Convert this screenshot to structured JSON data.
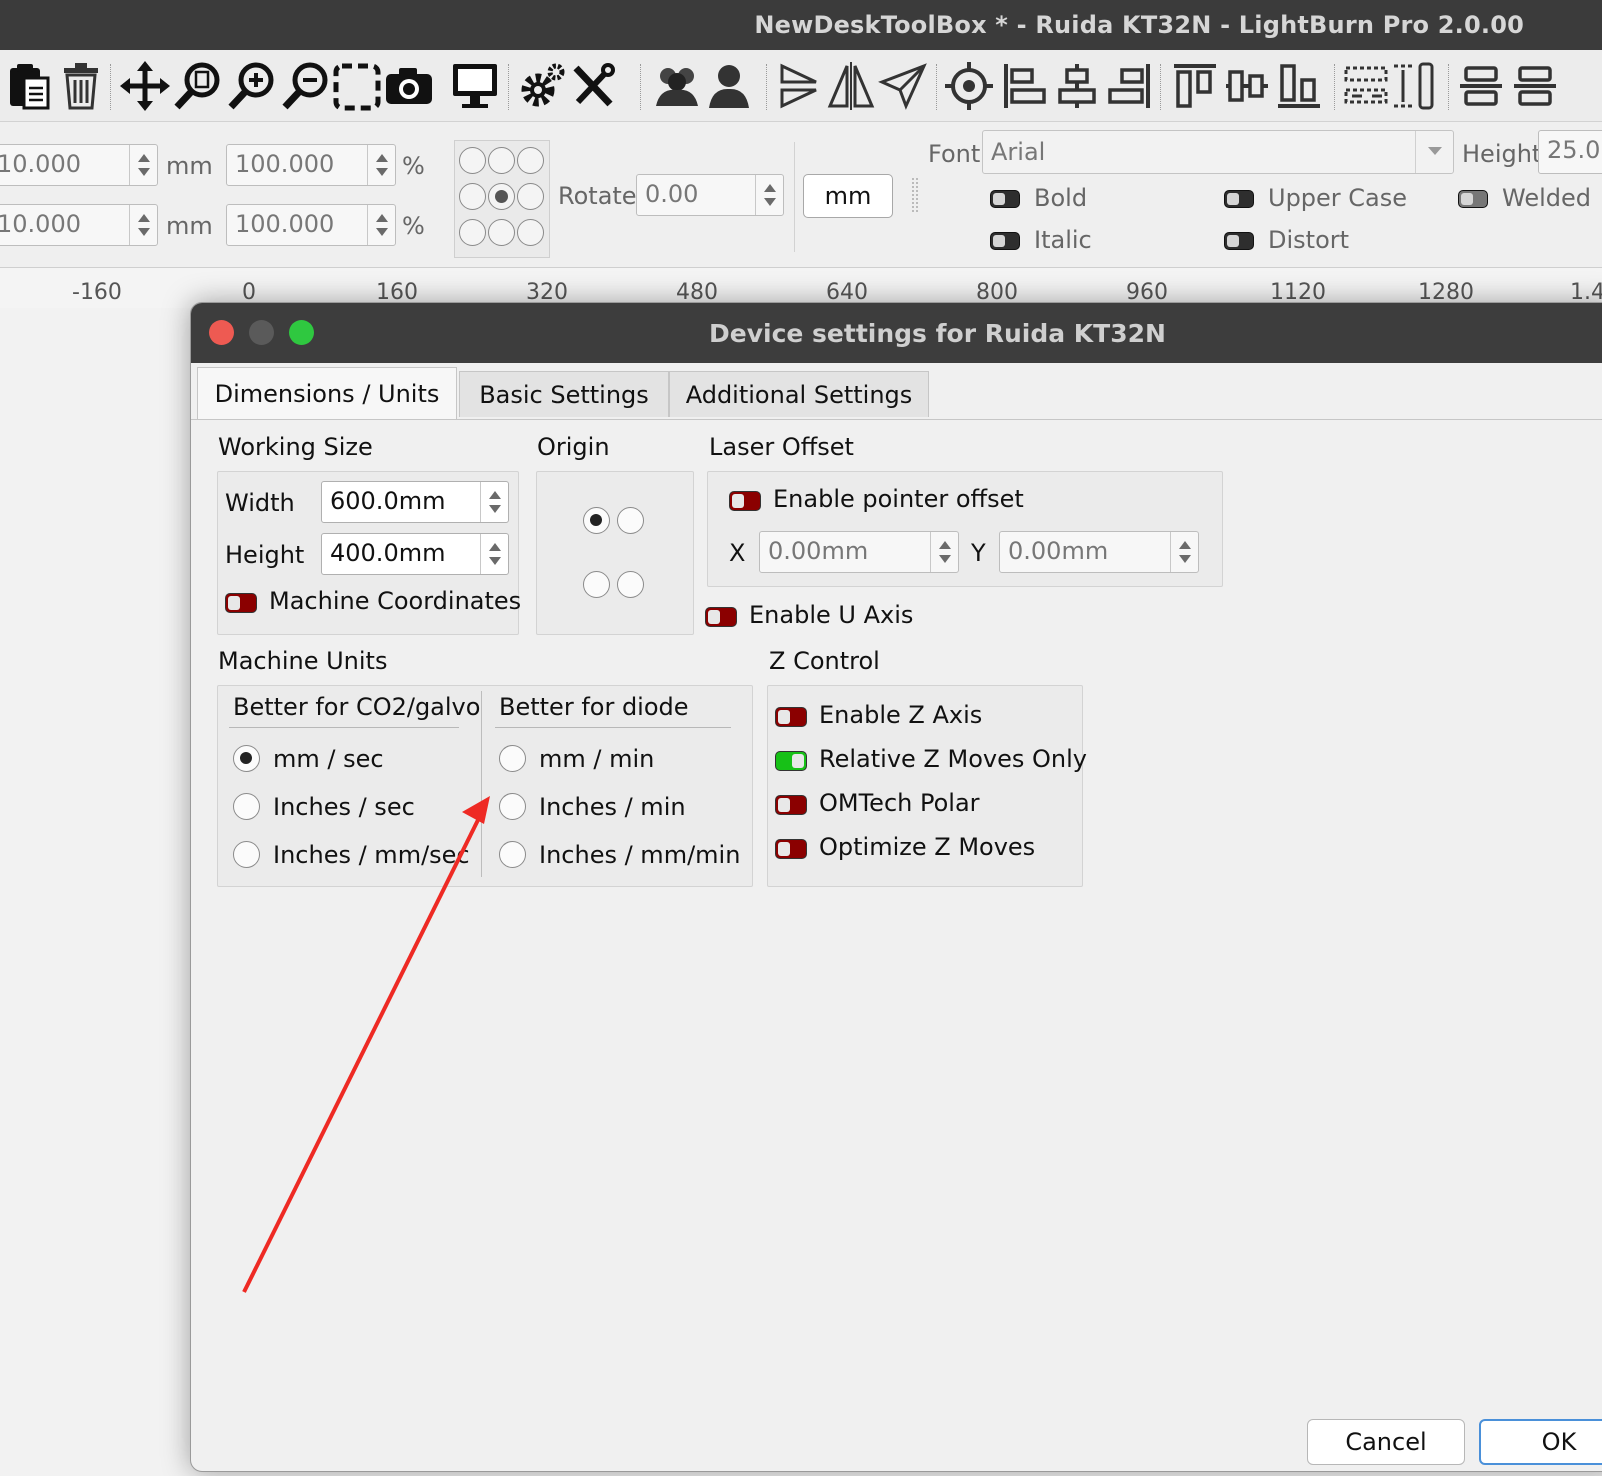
{
  "window": {
    "title": "NewDeskToolBox * - Ruida KT32N - LightBurn Pro 2.0.00"
  },
  "toolbar": {
    "icons": [
      "paste-icon",
      "delete-icon",
      "move-icon",
      "zoom-page-icon",
      "zoom-in-icon",
      "zoom-out-icon",
      "select-frame-icon",
      "camera-icon",
      "monitor-icon",
      "settings-icon",
      "tools-icon",
      "group-icon",
      "user-icon",
      "flip-h-icon",
      "mirror-icon",
      "plane-icon",
      "target-icon",
      "align-left-icon",
      "align-center-icon",
      "align-right-icon",
      "align-top-icon",
      "align-middle-icon",
      "align-bottom-icon",
      "distribute-h-icon",
      "distribute-v-icon",
      "space-h-icon",
      "space-v-icon"
    ]
  },
  "properties": {
    "x_value": "10.000",
    "y_value": "10.000",
    "x_unit": "mm",
    "y_unit": "mm",
    "w_pct": "100.000",
    "h_pct": "100.000",
    "pct_symbol": "%",
    "rotate_label": "Rotate",
    "rotate_value": "0.00",
    "unit_button": "mm",
    "font_label": "Font",
    "font_value": "Arial",
    "height_label": "Height",
    "height_value": "25.0",
    "bold": "Bold",
    "italic": "Italic",
    "upper_case": "Upper Case",
    "distort": "Distort",
    "welded": "Welded"
  },
  "ruler": {
    "ticks": [
      "-160",
      "0",
      "160",
      "320",
      "480",
      "640",
      "800",
      "960",
      "1120",
      "1280",
      "1.4"
    ]
  },
  "dialog": {
    "title": "Device settings for Ruida KT32N",
    "tabs": [
      "Dimensions / Units",
      "Basic Settings",
      "Additional Settings"
    ],
    "working_size": {
      "label": "Working Size",
      "width_label": "Width",
      "width_value": "600.0mm",
      "height_label": "Height",
      "height_value": "400.0mm",
      "machine_coords": "Machine Coordinates"
    },
    "origin_label": "Origin",
    "laser_offset": {
      "label": "Laser Offset",
      "enable_pointer": "Enable pointer offset",
      "x_label": "X",
      "x_value": "0.00mm",
      "y_label": "Y",
      "y_value": "0.00mm"
    },
    "enable_u_axis": "Enable U Axis",
    "machine_units": {
      "label": "Machine Units",
      "co2_header": "Better for CO2/galvo",
      "diode_header": "Better for diode",
      "co2_options": [
        "mm / sec",
        "Inches / sec",
        "Inches / mm/sec"
      ],
      "diode_options": [
        "mm / min",
        "Inches / min",
        "Inches / mm/min"
      ],
      "selected": "mm / sec"
    },
    "z_control": {
      "label": "Z Control",
      "items": [
        "Enable Z Axis",
        "Relative Z Moves Only",
        "OMTech Polar",
        "Optimize Z Moves"
      ],
      "states": [
        false,
        true,
        false,
        false
      ]
    },
    "buttons": {
      "cancel": "Cancel",
      "ok": "OK"
    }
  },
  "colors": {
    "annotation_arrow": "#ee2a24",
    "toggle_off": "#8b0000",
    "toggle_on": "#17c117",
    "close": "#ee5a52",
    "minimize": "#5a5a5a",
    "zoom": "#2fc840"
  }
}
